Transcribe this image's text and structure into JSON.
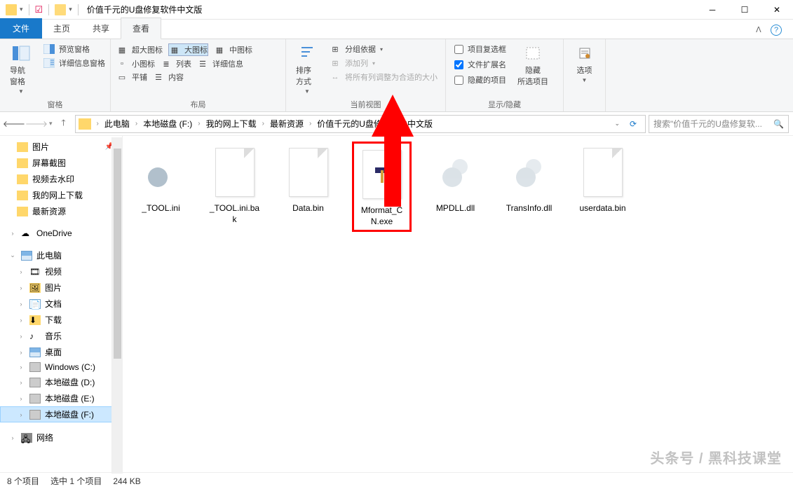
{
  "window": {
    "title": "价值千元的U盘修复软件中文版"
  },
  "tabs": {
    "file": "文件",
    "home": "主页",
    "share": "共享",
    "view": "查看"
  },
  "ribbon": {
    "panes": {
      "nav": "导航窗格",
      "preview": "预览窗格",
      "details": "详细信息窗格",
      "group_label": "窗格"
    },
    "layout": {
      "xl": "超大图标",
      "l": "大图标",
      "m": "中图标",
      "s": "小图标",
      "list": "列表",
      "detail": "详细信息",
      "tiles": "平铺",
      "content": "内容",
      "group_label": "布局"
    },
    "current": {
      "sort": "排序方式",
      "group": "分组依据",
      "addcol": "添加列",
      "fit": "将所有列调整为合适的大小",
      "group_label": "当前视图"
    },
    "showhide": {
      "chk1": "项目复选框",
      "chk2": "文件扩展名",
      "chk3": "隐藏的项目",
      "hide_sel": "隐藏\n所选项目",
      "group_label": "显示/隐藏"
    },
    "options": {
      "label": "选项"
    }
  },
  "breadcrumb": [
    "此电脑",
    "本地磁盘 (F:)",
    "我的网上下载",
    "最新资源",
    "价值千元的U盘修复软件中文版"
  ],
  "search_placeholder": "搜索\"价值千元的U盘修复软...",
  "sidebar": {
    "quick": [
      "图片",
      "屏幕截图",
      "视频去水印",
      "我的网上下载",
      "最新资源"
    ],
    "onedrive": "OneDrive",
    "thispc": "此电脑",
    "pc_items": [
      "视频",
      "图片",
      "文档",
      "下载",
      "音乐",
      "桌面",
      "Windows (C:)",
      "本地磁盘 (D:)",
      "本地磁盘 (E:)",
      "本地磁盘 (F:)"
    ],
    "network": "网络"
  },
  "files": [
    {
      "name": "_TOOL.ini",
      "kind": "gear"
    },
    {
      "name": "_TOOL.ini.bak",
      "kind": "blank"
    },
    {
      "name": "Data.bin",
      "kind": "blank"
    },
    {
      "name": "Mformat_CN.exe",
      "kind": "hammer",
      "highlight": true
    },
    {
      "name": "MPDLL.dll",
      "kind": "gears-light"
    },
    {
      "name": "TransInfo.dll",
      "kind": "gears-light"
    },
    {
      "name": "userdata.bin",
      "kind": "blank"
    }
  ],
  "status": {
    "count": "8 个项目",
    "selected": "选中 1 个项目",
    "size": "244 KB"
  },
  "watermark": "头条号 / 黑科技课堂"
}
